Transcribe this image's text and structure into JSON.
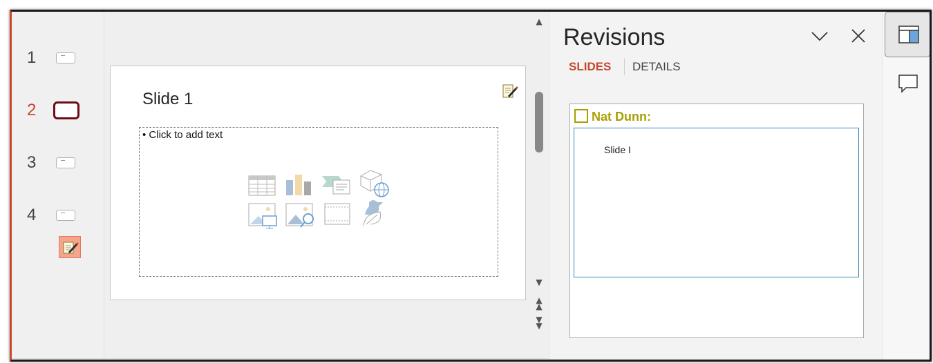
{
  "thumbnails": [
    {
      "number": "1",
      "active": false
    },
    {
      "number": "2",
      "active": true
    },
    {
      "number": "3",
      "active": false
    },
    {
      "number": "4",
      "active": false
    }
  ],
  "slide": {
    "title": "Slide 1",
    "placeholder_bullet": "• Click to add text",
    "insert_icons": [
      "table-icon",
      "chart-icon",
      "smartart-icon",
      "3d-model-icon",
      "picture-icon",
      "online-picture-icon",
      "video-icon",
      "icons-icon"
    ]
  },
  "revisions_pane": {
    "title": "Revisions",
    "tabs": {
      "slides": "SLIDES",
      "details": "DETAILS"
    },
    "author": "Nat Dunn:",
    "items": [
      "Slide I"
    ]
  },
  "colors": {
    "accent": "#c8472f",
    "author": "#a8a000",
    "active_thumb_border": "#6e0b14",
    "detail_border": "#2f86b3"
  }
}
